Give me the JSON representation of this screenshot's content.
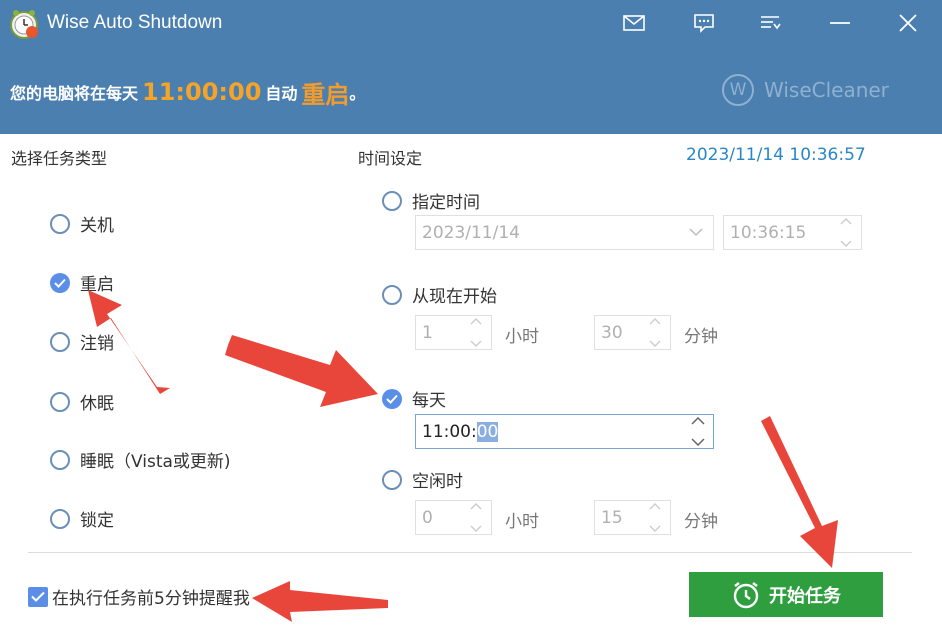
{
  "window": {
    "title": "Wise Auto Shutdown",
    "icons": [
      "mail-icon",
      "feedback-icon",
      "menu-icon",
      "minimize-icon",
      "close-icon"
    ]
  },
  "status": {
    "prefix": "您的电脑将在每天",
    "time": "11:00:00",
    "mid": "自动",
    "action": "重启",
    "suffix": "。"
  },
  "brand": {
    "logo_letter": "W",
    "name": "WiseCleaner"
  },
  "task_type": {
    "title": "选择任务类型",
    "options": [
      {
        "label": "关机",
        "checked": false
      },
      {
        "label": "重启",
        "checked": true
      },
      {
        "label": "注销",
        "checked": false
      },
      {
        "label": "休眠",
        "checked": false
      },
      {
        "label": "睡眠（Vista或更新)",
        "checked": false
      },
      {
        "label": "锁定",
        "checked": false
      }
    ]
  },
  "time_settings": {
    "title": "时间设定",
    "current_datetime": "2023/11/14 10:36:57",
    "specified": {
      "label": "指定时间",
      "checked": false,
      "date": "2023/11/14",
      "time": "10:36:15"
    },
    "from_now": {
      "label": "从现在开始",
      "checked": false,
      "hours": "1",
      "hours_unit": "小时",
      "minutes": "30",
      "minutes_unit": "分钟"
    },
    "daily": {
      "label": "每天",
      "checked": true,
      "time_main": "11:00:",
      "time_selected": "00"
    },
    "idle": {
      "label": "空闲时",
      "checked": false,
      "hours": "0",
      "hours_unit": "小时",
      "minutes": "15",
      "minutes_unit": "分钟"
    }
  },
  "reminder": {
    "label": "在执行任务前5分钟提醒我",
    "checked": true
  },
  "start_button": {
    "label": "开始任务"
  },
  "colors": {
    "header": "#4a7fb0",
    "accent": "#f39c2b",
    "radio": "#5b8ee6",
    "start": "#2e9e3e",
    "datetime": "#2b86c5",
    "arrow": "#e8463a"
  }
}
